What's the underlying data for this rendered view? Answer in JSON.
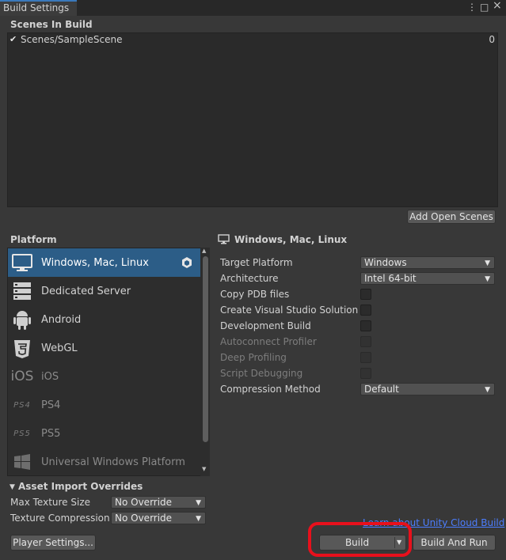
{
  "window": {
    "tab_title": "Build Settings",
    "menu_glyph": "⋮",
    "maximize_glyph": "□",
    "close_glyph": "×"
  },
  "scenes": {
    "heading": "Scenes In Build",
    "items": [
      {
        "name": "Scenes/SampleScene",
        "index": "0",
        "checked": true
      }
    ],
    "add_button": "Add Open Scenes"
  },
  "platform": {
    "heading": "Platform",
    "items": [
      {
        "label": "Windows, Mac, Linux",
        "icon": "monitor-icon",
        "selected": true,
        "enabled": true
      },
      {
        "label": "Dedicated Server",
        "icon": "server-icon",
        "selected": false,
        "enabled": true
      },
      {
        "label": "Android",
        "icon": "android-icon",
        "selected": false,
        "enabled": true
      },
      {
        "label": "WebGL",
        "icon": "html5-icon",
        "selected": false,
        "enabled": true
      },
      {
        "label": "iOS",
        "icon": "ios-icon",
        "selected": false,
        "enabled": false,
        "icon_text": "iOS"
      },
      {
        "label": "PS4",
        "icon": "ps4-icon",
        "selected": false,
        "enabled": false,
        "icon_text": "PS4"
      },
      {
        "label": "PS5",
        "icon": "ps5-icon",
        "selected": false,
        "enabled": false,
        "icon_text": "PS5"
      },
      {
        "label": "Universal Windows Platform",
        "icon": "windows-logo-icon",
        "selected": false,
        "enabled": false
      }
    ]
  },
  "settings": {
    "title": "Windows, Mac, Linux",
    "rows": [
      {
        "label": "Target Platform",
        "type": "dropdown",
        "value": "Windows",
        "enabled": true
      },
      {
        "label": "Architecture",
        "type": "dropdown",
        "value": "Intel 64-bit",
        "enabled": true
      },
      {
        "label": "Copy PDB files",
        "type": "checkbox",
        "checked": false,
        "enabled": true
      },
      {
        "label": "Create Visual Studio Solution",
        "type": "checkbox",
        "checked": false,
        "enabled": true
      },
      {
        "label": "Development Build",
        "type": "checkbox",
        "checked": false,
        "enabled": true
      },
      {
        "label": "Autoconnect Profiler",
        "type": "checkbox",
        "checked": false,
        "enabled": false
      },
      {
        "label": "Deep Profiling",
        "type": "checkbox",
        "checked": false,
        "enabled": false
      },
      {
        "label": "Script Debugging",
        "type": "checkbox",
        "checked": false,
        "enabled": false
      },
      {
        "label": "Compression Method",
        "type": "dropdown",
        "value": "Default",
        "enabled": true
      }
    ]
  },
  "asset_overrides": {
    "heading": "Asset Import Overrides",
    "rows": [
      {
        "label": "Max Texture Size",
        "value": "No Override"
      },
      {
        "label": "Texture Compression",
        "value": "No Override"
      }
    ]
  },
  "footer": {
    "cloud_link": "Learn about Unity Cloud Build",
    "player_settings": "Player Settings...",
    "build": "Build",
    "build_and_run": "Build And Run"
  },
  "colors": {
    "selection": "#2c5d87",
    "highlight_ring": "#e8101c",
    "link": "#4c7eff"
  }
}
